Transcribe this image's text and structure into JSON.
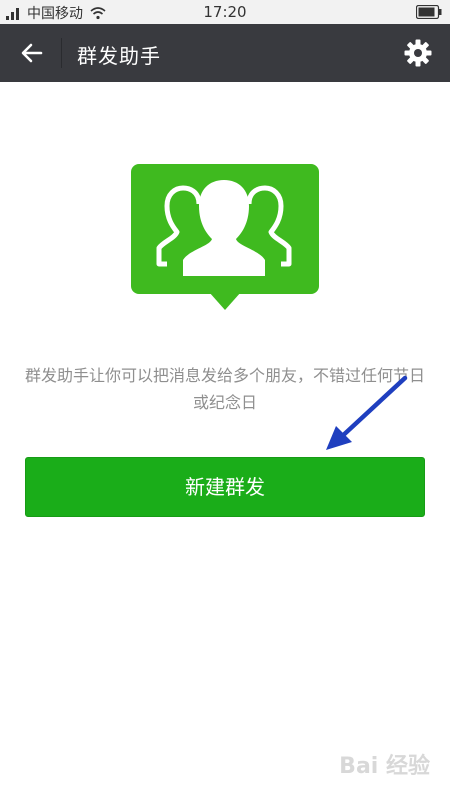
{
  "status_bar": {
    "carrier": "中国移动",
    "time": "17:20"
  },
  "header": {
    "title": "群发助手",
    "back_icon": "back-arrow-icon",
    "settings_icon": "gear-icon"
  },
  "main": {
    "illustration_icon": "group-contacts-icon",
    "description": "群发助手让你可以把消息发给多个朋友，不错过任何节日或纪念日",
    "new_broadcast_button": "新建群发"
  },
  "watermark": {
    "text": "Bai 经验"
  },
  "colors": {
    "title_bar": "#393a3f",
    "accent_green": "#1aad19",
    "illustration_green": "#3fba1f",
    "annotation_arrow": "#1f3fbf"
  }
}
